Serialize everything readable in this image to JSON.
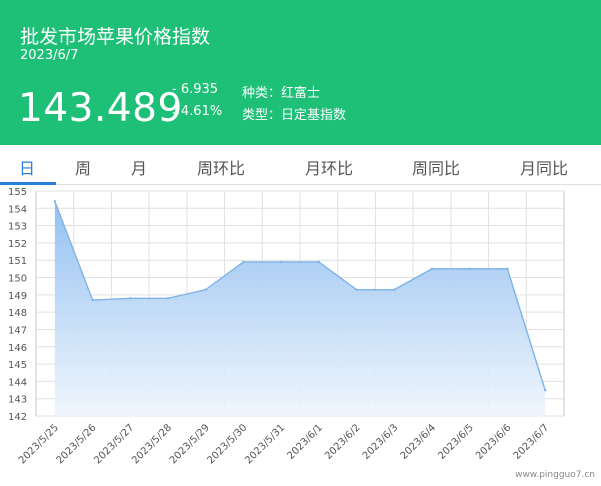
{
  "header": {
    "title": "批发市场苹果价格指数",
    "date": "2023/6/7",
    "price": "143.489",
    "change": "- 6.935",
    "pct": "↓4.61%",
    "variety_label": "种类：红富士",
    "type_label": "类型：日定基指数"
  },
  "tabs": [
    {
      "label": "日",
      "active": true
    },
    {
      "label": "周"
    },
    {
      "label": "月"
    },
    {
      "label": "周环比"
    },
    {
      "label": "月环比"
    },
    {
      "label": "周同比"
    },
    {
      "label": "月同比"
    }
  ],
  "watermark": "www.pingguo7.cn",
  "colors": {
    "brand": "#1ec078",
    "accent": "#2a7fd6",
    "line": "#7fb3e8"
  },
  "chart_data": {
    "type": "area",
    "x": [
      "2023/5/25",
      "2023/5/26",
      "2023/5/27",
      "2023/5/28",
      "2023/5/29",
      "2023/5/30",
      "2023/5/31",
      "2023/6/1",
      "2023/6/2",
      "2023/6/3",
      "2023/6/4",
      "2023/6/5",
      "2023/6/6",
      "2023/6/7"
    ],
    "values": [
      154.4,
      148.7,
      148.8,
      148.8,
      149.3,
      150.9,
      150.9,
      150.9,
      149.3,
      149.3,
      150.5,
      150.5,
      150.5,
      143.489
    ],
    "ylim": [
      142,
      155
    ],
    "yticks": [
      "142",
      "143",
      "144",
      "145",
      "146",
      "147",
      "148",
      "149",
      "150",
      "151",
      "152",
      "153",
      "154",
      "155"
    ],
    "grid": true
  }
}
